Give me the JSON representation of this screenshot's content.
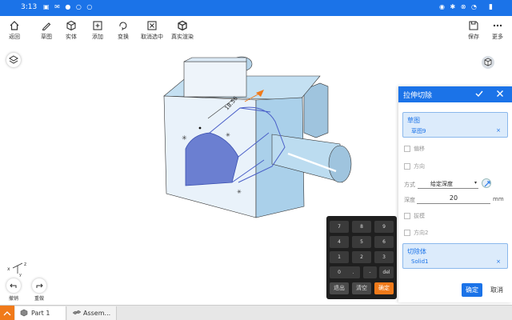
{
  "status": {
    "time": "3:13",
    "left_icons": "▣ ✉ ● ○ ○",
    "right_icons": "◉ ✱ ⊗ ◔",
    "battery": "▮"
  },
  "toolbar": {
    "back": "返回",
    "sketch": "草图",
    "solid": "实体",
    "add": "添加",
    "transform": "变换",
    "deselect": "取消选中",
    "render": "真实渲染",
    "save": "保存",
    "more": "更多"
  },
  "dimension_label": "18.56",
  "panel": {
    "title": "拉伸切除",
    "sketch_label": "草图",
    "sketch_value": "草图9",
    "remove_mark": "×",
    "offset_label": "偏移",
    "direction_label": "方向",
    "method_label": "方式",
    "method_value": "给定深度",
    "method_caret": "▾",
    "depth_label": "深度",
    "depth_value": "20",
    "unit": "mm",
    "draft_label": "拔模",
    "direction2_label": "方向2",
    "body_label": "切除体",
    "body_value": "Solid1",
    "confirm": "确定",
    "cancel": "取消"
  },
  "keypad": {
    "keys": [
      "7",
      "8",
      "9",
      "4",
      "5",
      "6",
      "1",
      "2",
      "3",
      "0",
      ".",
      "-",
      "del"
    ],
    "exit": "退出",
    "clear": "清空",
    "ok": "确定"
  },
  "axis": {
    "x": "x",
    "z": "z",
    "y": "y"
  },
  "bottom": {
    "undo": "撤销",
    "redo": "重做"
  },
  "tabs": [
    "Part 1",
    "Assem..."
  ],
  "colors": {
    "accent": "#1b73e8",
    "orange": "#f07a1a",
    "model": "#aad0ea",
    "cut": "#6b7fd1"
  }
}
